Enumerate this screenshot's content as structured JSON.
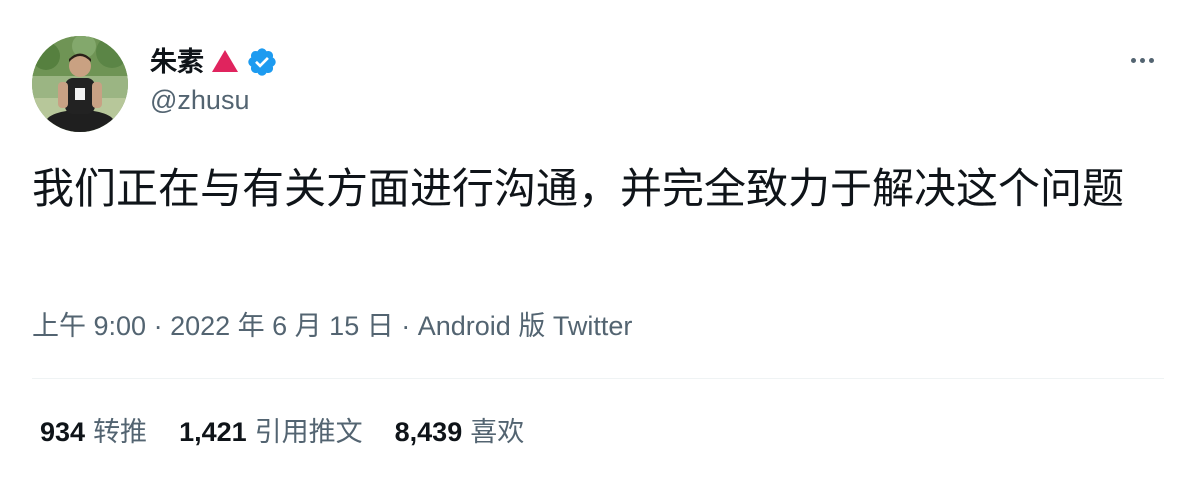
{
  "author": {
    "display_name": "朱素",
    "handle": "@zhusu",
    "verified": true,
    "badge_icon": "red-triangle-icon",
    "verified_icon": "verified-badge-icon",
    "accent_color": "#1d9bf0",
    "triangle_color": "#e0245e"
  },
  "menu": {
    "icon": "more-options-icon"
  },
  "tweet": {
    "text": "我们正在与有关方面进行沟通，并完全致力于解决这个问题"
  },
  "meta": {
    "time": "上午 9:00",
    "separator": "·",
    "date": "2022 年 6 月 15 日",
    "source": "Android 版 Twitter"
  },
  "stats": {
    "retweets_count": "934",
    "retweets_label": "转推",
    "quotes_count": "1,421",
    "quotes_label": "引用推文",
    "likes_count": "8,439",
    "likes_label": "喜欢"
  }
}
